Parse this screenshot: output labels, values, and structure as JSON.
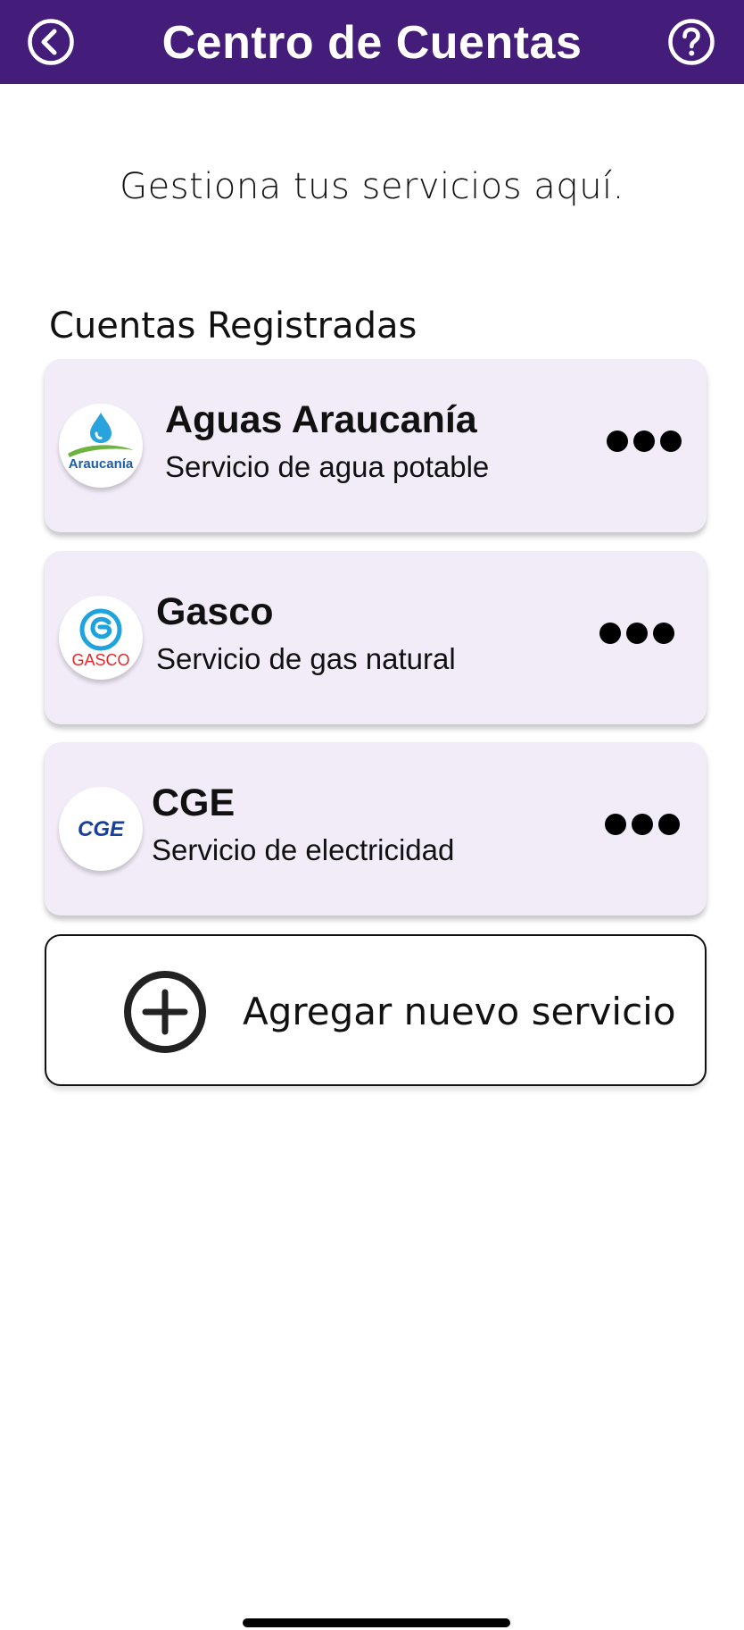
{
  "header": {
    "title": "Centro de Cuentas",
    "back_icon": "chevron-left-circle",
    "help_icon": "question-circle",
    "background_color": "#441c7a"
  },
  "subtitle": "Gestiona tus servicios aquí.",
  "section_title": "Cuentas Registradas",
  "accounts": [
    {
      "name": "Aguas Araucanía",
      "description": "Servicio de agua potable",
      "logo_text": "Araucanía",
      "logo_icon": "water-drop-icon"
    },
    {
      "name": "Gasco",
      "description": "Servicio de gas natural",
      "logo_text": "GASCO",
      "logo_icon": "gasco-swirl-icon"
    },
    {
      "name": "CGE",
      "description": "Servicio de electricidad",
      "logo_text": "CGE",
      "logo_icon": "cge-logo"
    }
  ],
  "add_service": {
    "label": "Agregar nuevo servicio",
    "icon": "plus-circle"
  },
  "colors": {
    "card_background": "#f2ebf8",
    "brand_purple": "#441c7a"
  }
}
